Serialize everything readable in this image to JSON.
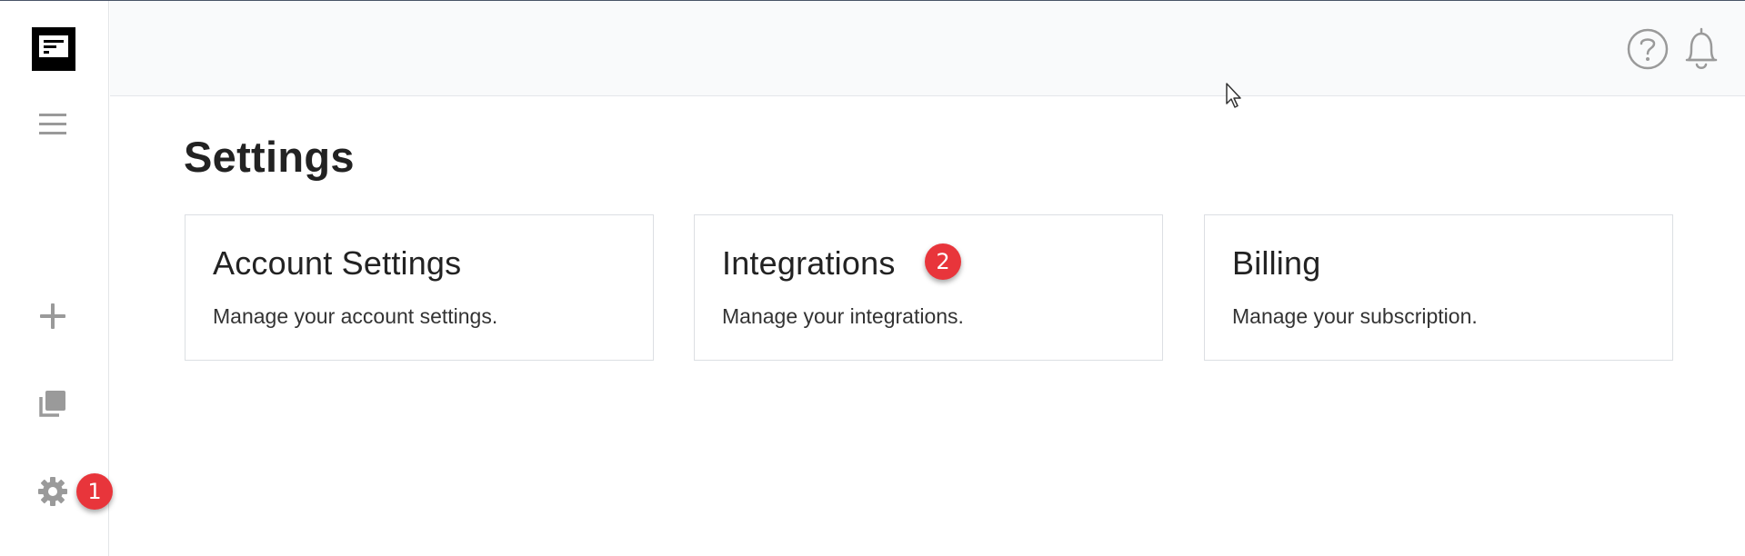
{
  "sidebar": {
    "logo_icon": "app-logo",
    "items": [
      {
        "name": "menu",
        "icon": "hamburger-icon"
      },
      {
        "name": "add",
        "icon": "plus-icon"
      },
      {
        "name": "copies",
        "icon": "stack-icon"
      },
      {
        "name": "settings",
        "icon": "gear-icon"
      }
    ],
    "settings_badge": "1"
  },
  "header": {
    "help_icon": "question-circle-icon",
    "notifications_icon": "bell-icon"
  },
  "main": {
    "title": "Settings",
    "cards": [
      {
        "title": "Account Settings",
        "description": "Manage your account settings."
      },
      {
        "title": "Integrations",
        "description": "Manage your integrations.",
        "badge": "2"
      },
      {
        "title": "Billing",
        "description": "Manage your subscription."
      }
    ]
  },
  "colors": {
    "badge": "#e8353b",
    "icon_gray": "#9a9a9a",
    "header_bg": "#f9fafb"
  }
}
